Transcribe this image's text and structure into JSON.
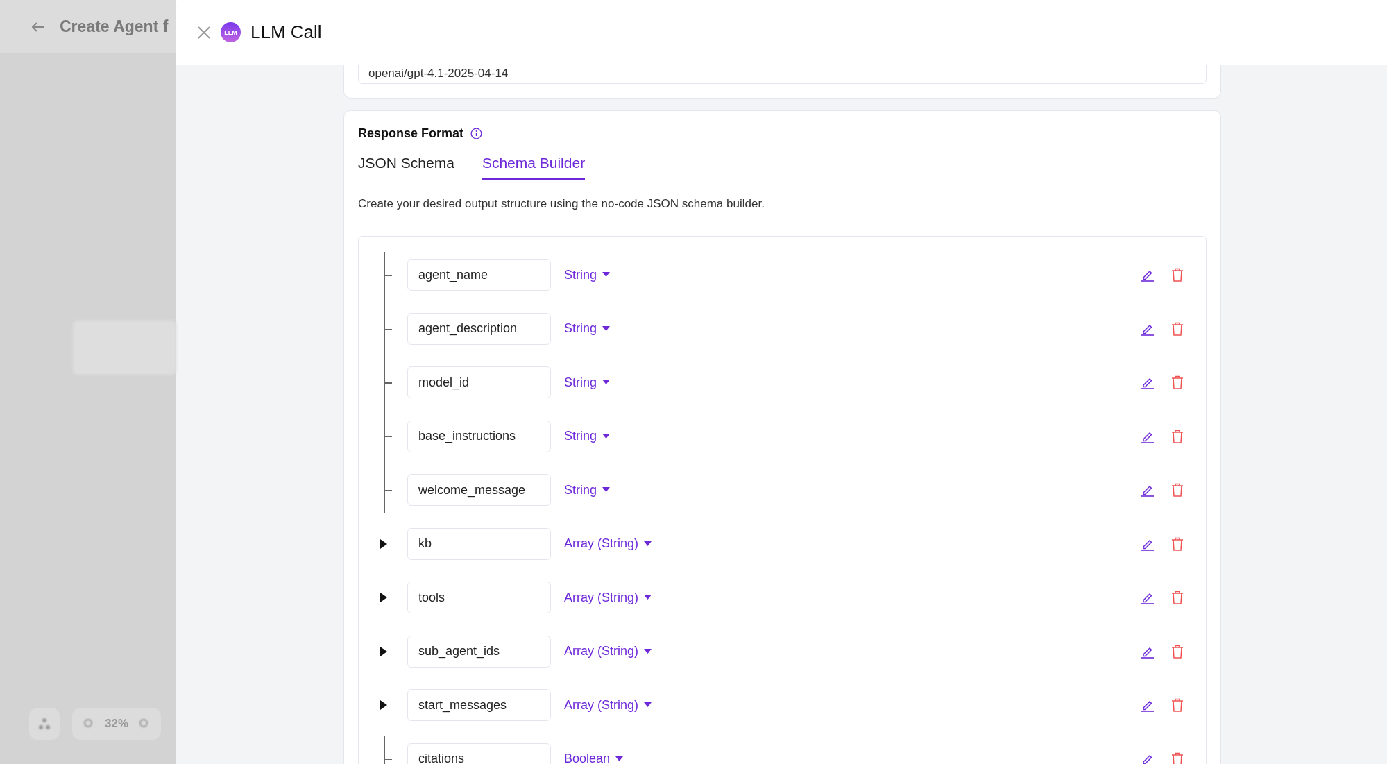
{
  "background_page": {
    "title": "Create Agent f",
    "zoom": "32%"
  },
  "panel": {
    "title": "LLM Call",
    "logo": "LLM"
  },
  "model_field": {
    "value": "openai/gpt-4.1-2025-04-14"
  },
  "response_format": {
    "title": "Response Format",
    "tabs": [
      {
        "label": "JSON Schema",
        "selected": false
      },
      {
        "label": "Schema Builder",
        "selected": true
      }
    ],
    "description": "Create your desired output structure using the no-code JSON schema builder.",
    "fields": [
      {
        "kind": "leaf",
        "name": "agent_name",
        "type": "String"
      },
      {
        "kind": "leaf",
        "name": "agent_description",
        "type": "String"
      },
      {
        "kind": "leaf",
        "name": "model_id",
        "type": "String"
      },
      {
        "kind": "leaf",
        "name": "base_instructions",
        "type": "String"
      },
      {
        "kind": "leaf",
        "name": "welcome_message",
        "type": "String"
      },
      {
        "kind": "group",
        "expanded": false,
        "name": "kb",
        "type": "Array (String)"
      },
      {
        "kind": "group",
        "expanded": false,
        "name": "tools",
        "type": "Array (String)"
      },
      {
        "kind": "group",
        "expanded": false,
        "name": "sub_agent_ids",
        "type": "Array (String)"
      },
      {
        "kind": "group",
        "expanded": false,
        "name": "start_messages",
        "type": "Array (String)"
      },
      {
        "kind": "leaf",
        "name": "citations",
        "type": "Boolean"
      }
    ]
  }
}
